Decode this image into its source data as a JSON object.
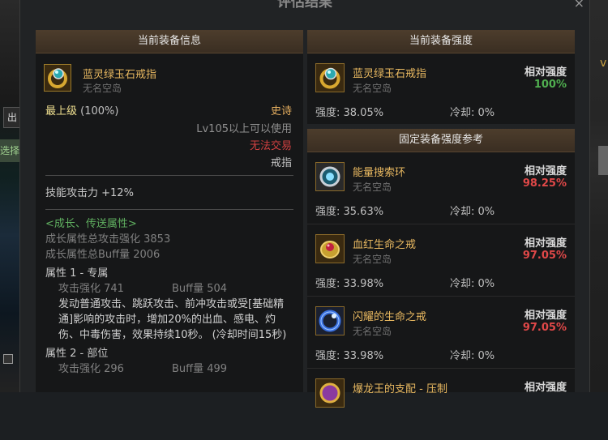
{
  "dialog": {
    "title": "评估结果",
    "close": "×"
  },
  "left_panel": {
    "header": "当前装备信息",
    "item": {
      "name": "蓝灵绿玉石戒指",
      "sub": "无名空岛"
    },
    "grade": "最上级",
    "grade_pct": "(100%)",
    "rarity": "史诗",
    "level_req": "Lv105以上可以使用",
    "trade": "无法交易",
    "slot": "戒指",
    "skill": "技能攻击力   +12%",
    "growth": {
      "title": "<成长、传送属性>",
      "total_attack": "成长属性总攻击强化 3853",
      "total_buff": "成长属性总Buff量 2006"
    },
    "attr1": {
      "title": "属性 1 - 专属",
      "attack": "攻击强化   741",
      "buff": "Buff量   504",
      "desc": "发动普通攻击、跳跃攻击、前冲攻击或受[基础精通]影响的攻击时，增加20%的出血、感电、灼伤、中毒伤害，效果持续10秒。 (冷却时间15秒)"
    },
    "attr2": {
      "title": "属性 2 - 部位",
      "attack": "攻击强化   296",
      "buff": "Buff量   499"
    }
  },
  "current_strength": {
    "header": "当前装备强度",
    "item": {
      "name": "蓝灵绿玉石戒指",
      "sub": "无名空岛",
      "rel_label": "相对强度",
      "rel_value": "100%",
      "strength": "强度: 38.05%",
      "cooldown": "冷却: 0%"
    }
  },
  "reference": {
    "header": "固定装备强度参考",
    "items": [
      {
        "name": "能量搜索环",
        "sub": "无名空岛",
        "rel_label": "相对强度",
        "rel_value": "98.25%",
        "strength": "强度: 35.63%",
        "cooldown": "冷却: 0%"
      },
      {
        "name": "血红生命之戒",
        "sub": "无名空岛",
        "rel_label": "相对强度",
        "rel_value": "97.05%",
        "strength": "强度: 33.98%",
        "cooldown": "冷却: 0%"
      },
      {
        "name": "闪耀的生命之戒",
        "sub": "无名空岛",
        "rel_label": "相对强度",
        "rel_value": "97.05%",
        "strength": "强度: 33.98%",
        "cooldown": "冷却: 0%"
      },
      {
        "name": "爆龙王的支配 - 压制",
        "sub": "",
        "rel_label": "相对强度",
        "rel_value": "",
        "strength": "",
        "cooldown": ""
      }
    ]
  },
  "background": {
    "left_tab": "出",
    "left_tab2": "选择",
    "right_glyph": "v"
  },
  "colors": {
    "relative_best": "#50b050",
    "relative_lower": "#e04848",
    "item_name": "#e8b860"
  }
}
